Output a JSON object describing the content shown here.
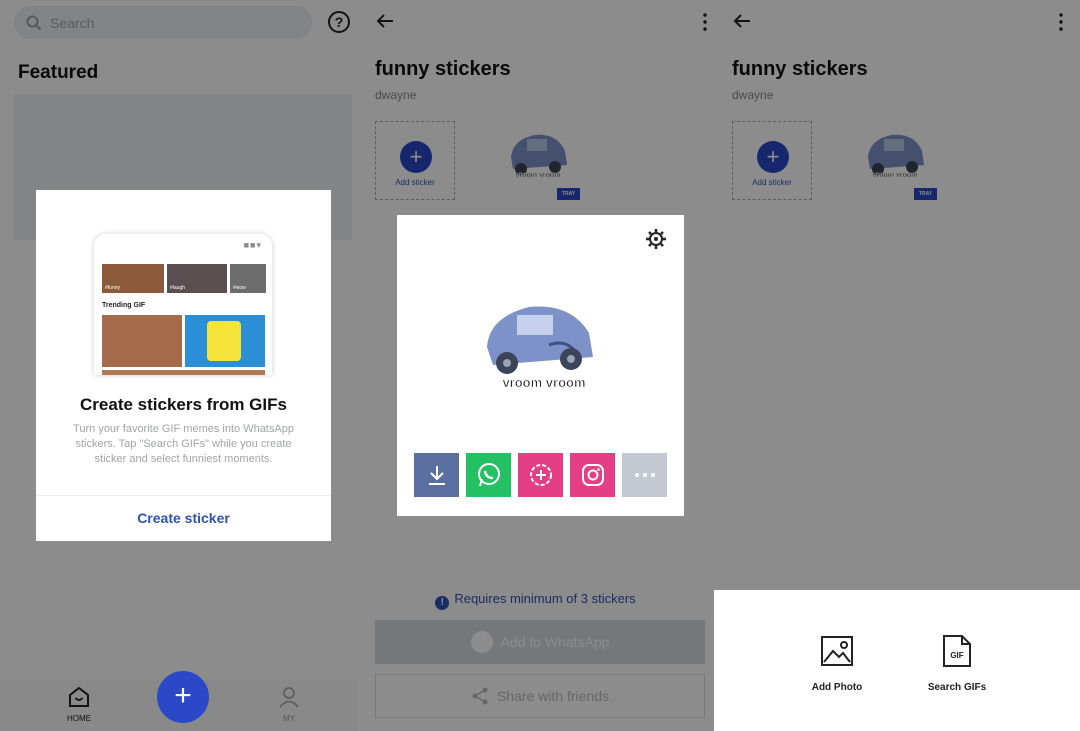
{
  "home": {
    "search_placeholder": "Search",
    "help_label": "?",
    "featured_title": "Featured",
    "nav": {
      "home_label": "HOME",
      "my_label": "MY"
    },
    "fab_label": "+",
    "dialog": {
      "mock_tags": [
        "#funny",
        "#laugh",
        "#wow"
      ],
      "mock_section": "Trending GIF",
      "title": "Create stickers from GIFs",
      "description": "Turn your favorite GIF memes into WhatsApp stickers. Tap \"Search GIFs\" while you create sticker and select funniest moments.",
      "button": "Create sticker"
    }
  },
  "pack": {
    "title": "funny stickers",
    "author": "dwayne",
    "add_sticker_label": "Add sticker",
    "sticker_caption": "vroom vroom",
    "tray_badge": "TRAY",
    "requirement": "Requires minimum of 3 stickers",
    "add_to_whatsapp": "Add to WhatsApp",
    "share_with_friends": "Share with friends",
    "preview": {
      "caption": "vroom vroom",
      "share_buttons": [
        {
          "icon": "download-icon",
          "color": "#5a6ea0"
        },
        {
          "icon": "whatsapp-icon",
          "color": "#23c163"
        },
        {
          "icon": "add-status-icon",
          "color": "#e43f86"
        },
        {
          "icon": "instagram-icon",
          "color": "#e43f86"
        },
        {
          "icon": "more-icon",
          "color": "#c4c8d0"
        }
      ]
    }
  },
  "sheet": {
    "add_photo": "Add Photo",
    "search_gifs": "Search GIFs",
    "gif_icon_text": "GIF"
  },
  "colors": {
    "primary": "#2a48c8",
    "link": "#2d52b8"
  }
}
